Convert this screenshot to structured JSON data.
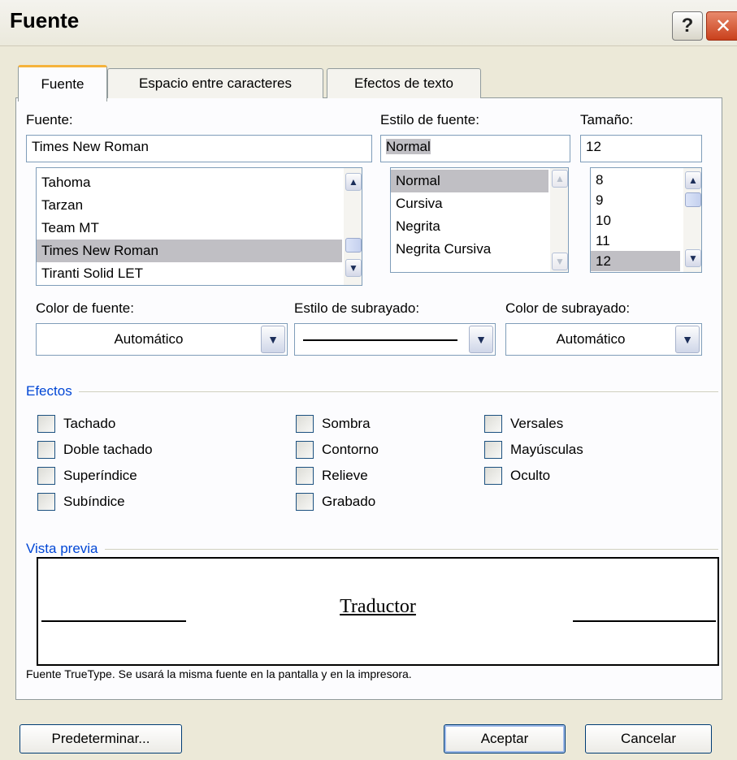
{
  "window": {
    "title": "Fuente",
    "help_label": "?",
    "close_label": "✕"
  },
  "tabs": [
    "Fuente",
    "Espacio entre caracteres",
    "Efectos de texto"
  ],
  "font": {
    "label": "Fuente:",
    "value": "Times New Roman",
    "items": [
      "Tahoma",
      "Tarzan",
      "Team MT",
      "Times New Roman",
      "Tiranti Solid LET"
    ],
    "selected": "Times New Roman"
  },
  "style": {
    "label": "Estilo de fuente:",
    "value": "Normal",
    "items": [
      "Normal",
      "Cursiva",
      "Negrita",
      "Negrita Cursiva"
    ],
    "selected": "Normal"
  },
  "size": {
    "label": "Tamaño:",
    "value": "12",
    "items": [
      "8",
      "9",
      "10",
      "11",
      "12"
    ],
    "selected": "12"
  },
  "font_color": {
    "label": "Color de fuente:",
    "value": "Automático"
  },
  "underline_style": {
    "label": "Estilo de subrayado:",
    "value": ""
  },
  "underline_color": {
    "label": "Color de subrayado:",
    "value": "Automático"
  },
  "effects": {
    "title": "Efectos",
    "col1": [
      "Tachado",
      "Doble tachado",
      "Superíndice",
      "Subíndice"
    ],
    "col2": [
      "Sombra",
      "Contorno",
      "Relieve",
      "Grabado"
    ],
    "col3": [
      "Versales",
      "Mayúsculas",
      "Oculto"
    ]
  },
  "preview": {
    "title": "Vista previa",
    "sample": "Traductor",
    "note": "Fuente TrueType. Se usará la misma fuente en la pantalla y en la impresora."
  },
  "buttons": {
    "default": "Predeterminar...",
    "ok": "Aceptar",
    "cancel": "Cancelar"
  },
  "icons": {
    "scroll_up": "chevron-up-icon",
    "scroll_down": "chevron-down-icon",
    "dropdown": "chevron-down-icon"
  }
}
